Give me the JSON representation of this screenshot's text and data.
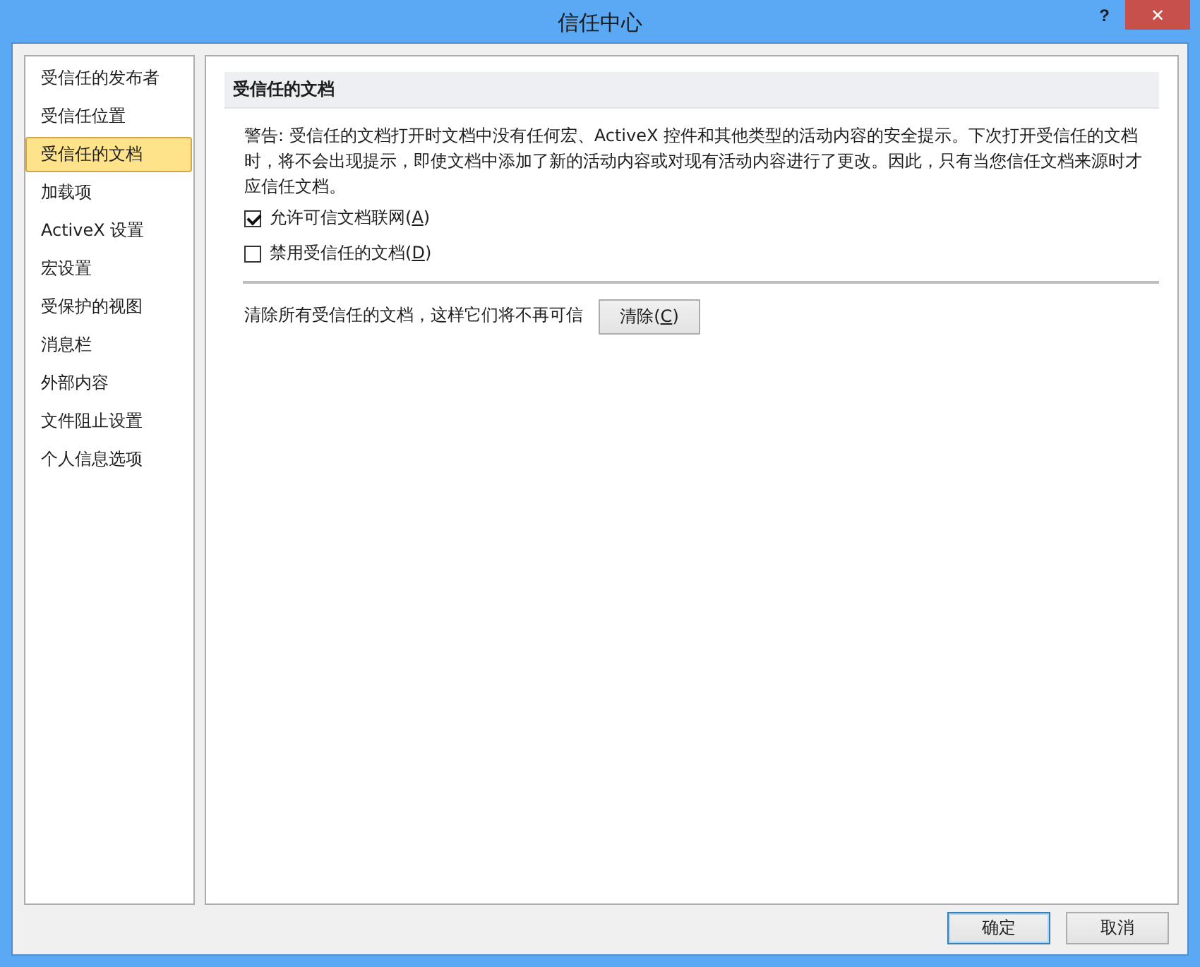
{
  "window": {
    "title": "信任中心",
    "help": "?",
    "close": "✕"
  },
  "sidebar": {
    "items": [
      {
        "label": "受信任的发布者",
        "selected": false
      },
      {
        "label": "受信任位置",
        "selected": false
      },
      {
        "label": "受信任的文档",
        "selected": true
      },
      {
        "label": "加载项",
        "selected": false
      },
      {
        "label": "ActiveX 设置",
        "selected": false
      },
      {
        "label": "宏设置",
        "selected": false
      },
      {
        "label": "受保护的视图",
        "selected": false
      },
      {
        "label": "消息栏",
        "selected": false
      },
      {
        "label": "外部内容",
        "selected": false
      },
      {
        "label": "文件阻止设置",
        "selected": false
      },
      {
        "label": "个人信息选项",
        "selected": false
      }
    ]
  },
  "section": {
    "heading": "受信任的文档",
    "warning": "警告: 受信任的文档打开时文档中没有任何宏、ActiveX 控件和其他类型的活动内容的安全提示。下次打开受信任的文档时，将不会出现提示，即使文档中添加了新的活动内容或对现有活动内容进行了更改。因此，只有当您信任文档来源时才应信任文档。",
    "options": [
      {
        "label": "允许可信文档联网(A)",
        "checked": true
      },
      {
        "label": "禁用受信任的文档(D)",
        "checked": false
      }
    ],
    "clear_text": "清除所有受信任的文档，这样它们将不再可信",
    "clear_button": {
      "label": "清除(C)"
    }
  },
  "buttons": [
    {
      "label": "确定",
      "selected": true
    },
    {
      "label": "取消",
      "selected": false
    }
  ]
}
